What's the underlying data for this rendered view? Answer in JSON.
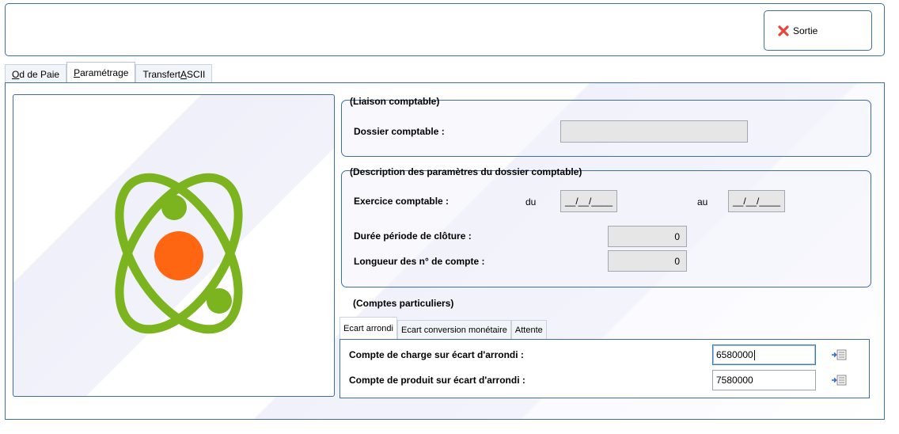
{
  "toolbar": {
    "exit_label": "Sortie"
  },
  "tabs": [
    {
      "prefix": "",
      "accel": "O",
      "rest": "d de Paie"
    },
    {
      "prefix": "",
      "accel": "P",
      "rest": "aramétrage"
    },
    {
      "prefix": "Transfert ",
      "accel": "A",
      "rest": "SCII"
    }
  ],
  "liaison": {
    "title": "(Liaison comptable)",
    "dossier_label": "Dossier comptable :",
    "dossier_value": ""
  },
  "description": {
    "title": "(Description des paramètres du dossier comptable)",
    "exercice_label": "Exercice comptable :",
    "du_label": "du",
    "du_value": "__/__/____",
    "au_label": "au",
    "au_value": "__/__/____",
    "duree_label": "Durée période de clôture :",
    "duree_value": "0",
    "longueur_label": "Longueur des n° de compte :",
    "longueur_value": "0"
  },
  "comptes": {
    "title": "(Comptes particuliers)",
    "subtabs": [
      "Ecart arrondi",
      "Ecart conversion monétaire",
      "Attente"
    ],
    "charge_label": "Compte de charge sur écart d'arrondi :",
    "charge_value": "6580000",
    "produit_label": "Compte de produit sur écart d'arrondi :",
    "produit_value": "7580000"
  },
  "icons": {
    "exit": "close-x-icon",
    "atom": "atom-icon",
    "lookup": "lookup-list-icon"
  },
  "colors": {
    "border": "#3d6ea6",
    "atom_orbit": "#7bb41e",
    "atom_nucleus": "#ff6612",
    "exit_icon": "#e8443a"
  }
}
